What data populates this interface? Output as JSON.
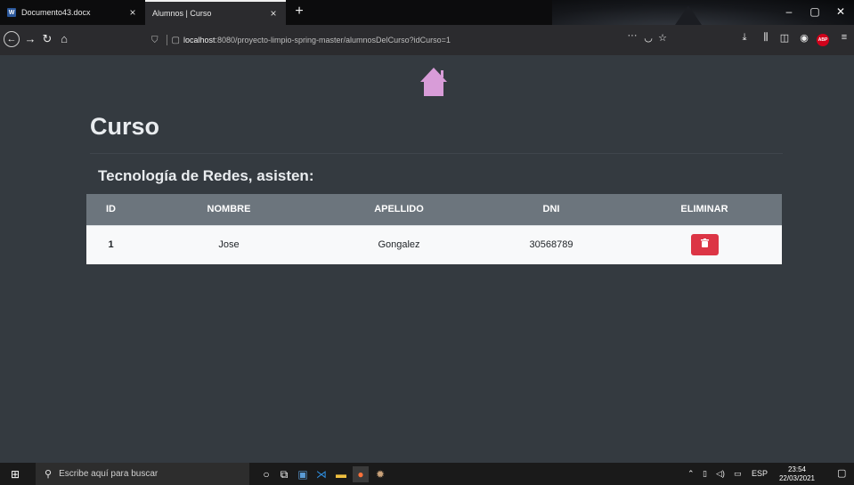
{
  "browser": {
    "tabs": [
      {
        "label": "Documento43.docx",
        "active": false
      },
      {
        "label": "Alumnos | Curso",
        "active": true
      }
    ],
    "url_host": "localhost",
    "url_rest": ":8080/proyecto-limpio-spring-master/alumnosDelCurso?idCurso=1",
    "tab_close": "×",
    "new_tab": "+",
    "addon_label": "ABP"
  },
  "page": {
    "title": "Curso",
    "subtitle": "Tecnología de Redes, asisten:",
    "home_icon_color": "#d89cd8",
    "table": {
      "headers": [
        "ID",
        "NOMBRE",
        "APELLIDO",
        "DNI",
        "ELIMINAR"
      ],
      "rows": [
        {
          "id": "1",
          "nombre": "Jose",
          "apellido": "Gongalez",
          "dni": "30568789"
        }
      ]
    },
    "delete_color": "#dc3545"
  },
  "taskbar": {
    "search_placeholder": "Escribe aquí para buscar",
    "language": "ESP",
    "time": "23:54",
    "date": "22/03/2021"
  }
}
